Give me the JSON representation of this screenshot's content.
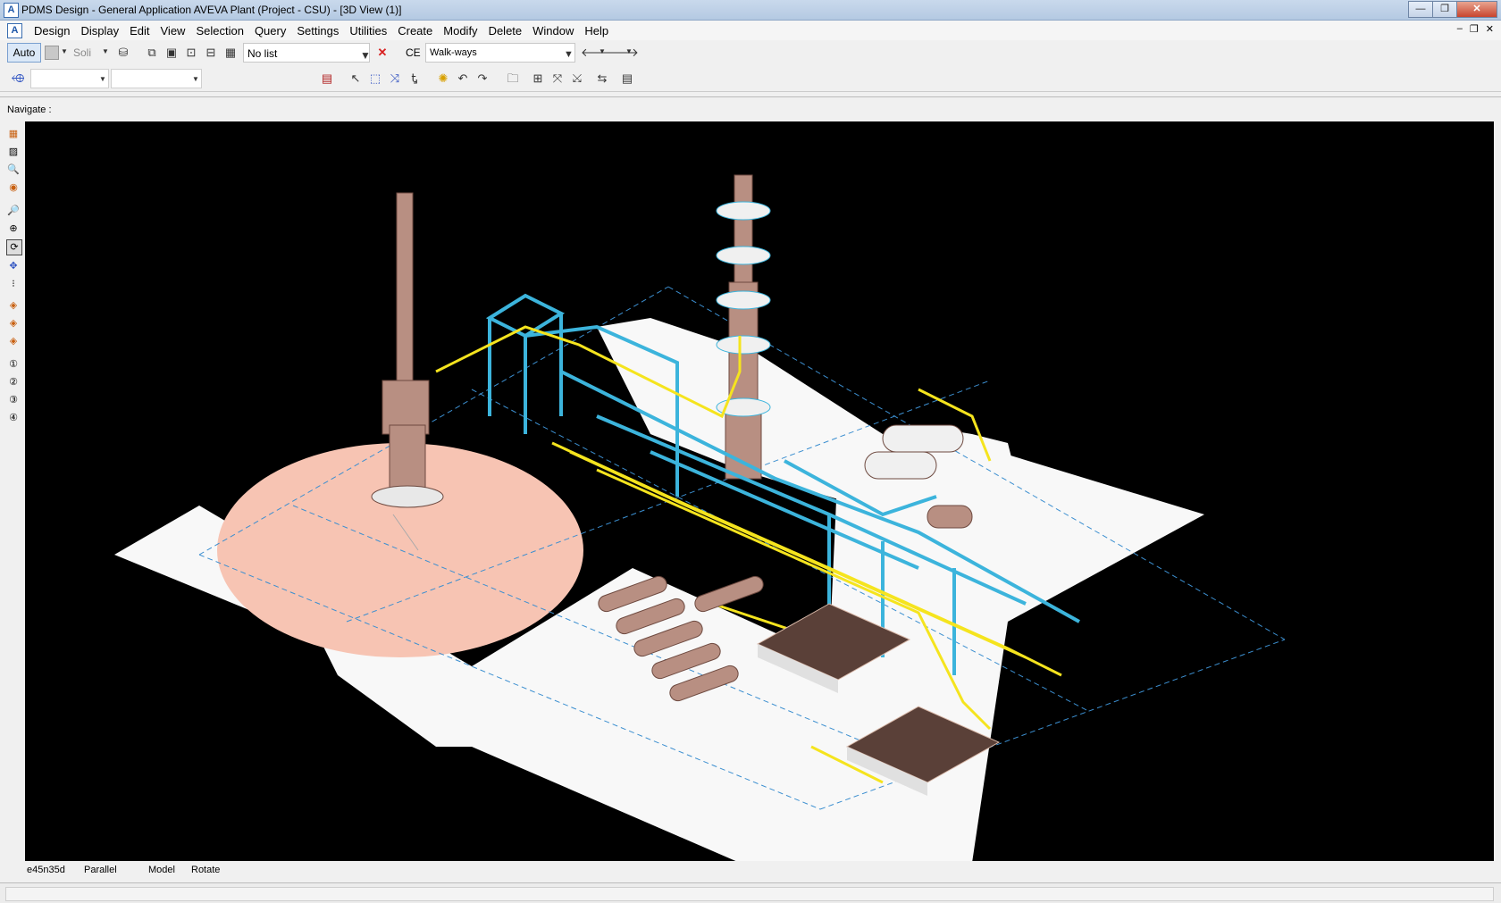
{
  "window": {
    "title": "PDMS Design - General Application  AVEVA Plant (Project - CSU) - [3D View (1)]",
    "controls": {
      "minimize": "—",
      "restore": "❐",
      "close": "✕"
    }
  },
  "menubar": {
    "items": [
      "Design",
      "Display",
      "Edit",
      "View",
      "Selection",
      "Query",
      "Settings",
      "Utilities",
      "Create",
      "Modify",
      "Delete",
      "Window",
      "Help"
    ],
    "mdi_controls": [
      "–",
      "❐",
      "✕"
    ]
  },
  "toolbar1": {
    "auto_label": "Auto",
    "solid_label": "Soli",
    "list_value": "No list",
    "ce_label": "CE",
    "ce_value": "Walk-ways"
  },
  "navigate": {
    "label": "Navigate :"
  },
  "status": {
    "view_direction": "e45n35d",
    "projection": "Parallel",
    "mode": "Model",
    "action": "Rotate"
  },
  "colors": {
    "viewport_bg": "#000000",
    "ground": "#f8f8f8",
    "vessel": "#b88f82",
    "steel": "#3cb4dc",
    "pipe": "#f5e41e",
    "zone": "#f7c4b3"
  },
  "icons": {
    "delete": "red-x-icon",
    "back": "arrow-left-icon",
    "forward": "arrow-right-icon"
  }
}
